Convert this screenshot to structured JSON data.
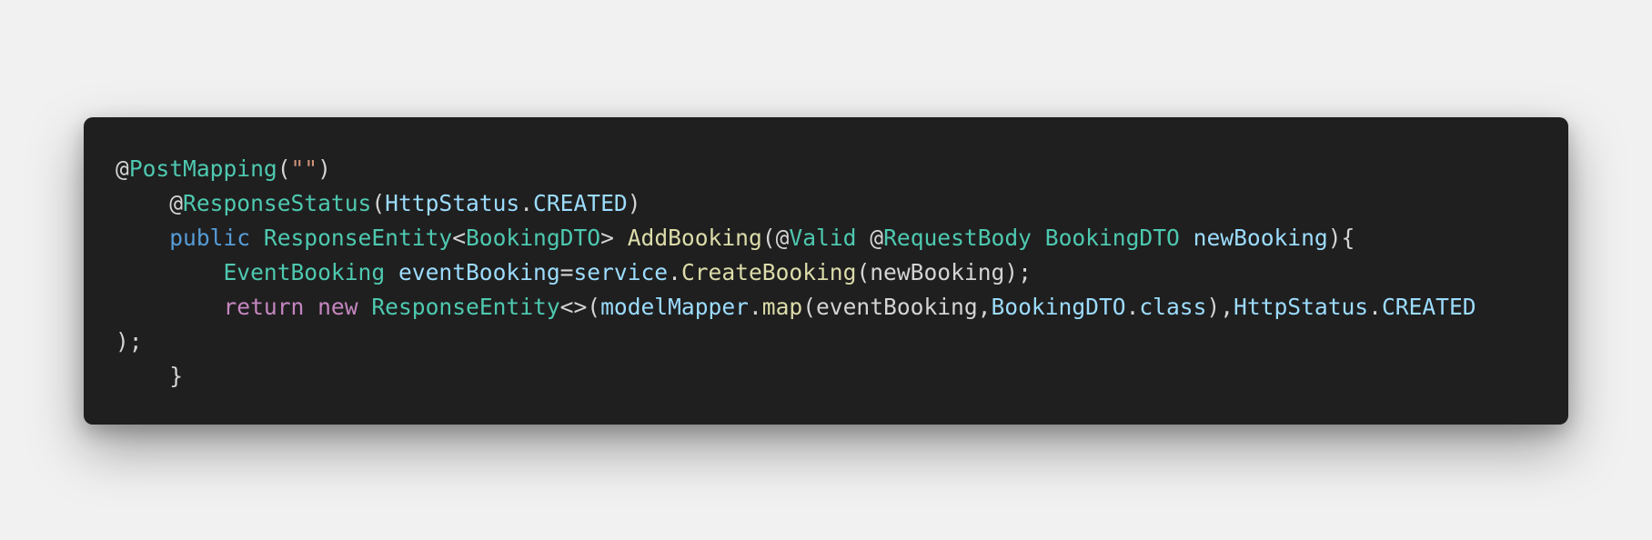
{
  "code_block": {
    "lines": [
      [
        {
          "t": "@",
          "c": "at"
        },
        {
          "t": "PostMapping",
          "c": "type"
        },
        {
          "t": "(",
          "c": "punc"
        },
        {
          "t": "\"\"",
          "c": "str"
        },
        {
          "t": ")",
          "c": "punc"
        }
      ],
      [
        {
          "t": "    @",
          "c": "at"
        },
        {
          "t": "ResponseStatus",
          "c": "type"
        },
        {
          "t": "(",
          "c": "punc"
        },
        {
          "t": "HttpStatus",
          "c": "var"
        },
        {
          "t": ".",
          "c": "punc"
        },
        {
          "t": "CREATED",
          "c": "var"
        },
        {
          "t": ")",
          "c": "punc"
        }
      ],
      [
        {
          "t": "    ",
          "c": "punc"
        },
        {
          "t": "public",
          "c": "kw"
        },
        {
          "t": " ",
          "c": "punc"
        },
        {
          "t": "ResponseEntity",
          "c": "type"
        },
        {
          "t": "<",
          "c": "punc"
        },
        {
          "t": "BookingDTO",
          "c": "type"
        },
        {
          "t": "> ",
          "c": "punc"
        },
        {
          "t": "AddBooking",
          "c": "fn"
        },
        {
          "t": "(@",
          "c": "punc"
        },
        {
          "t": "Valid",
          "c": "type"
        },
        {
          "t": " @",
          "c": "punc"
        },
        {
          "t": "RequestBody",
          "c": "type"
        },
        {
          "t": " ",
          "c": "punc"
        },
        {
          "t": "BookingDTO",
          "c": "type"
        },
        {
          "t": " ",
          "c": "punc"
        },
        {
          "t": "newBooking",
          "c": "var"
        },
        {
          "t": "){",
          "c": "punc"
        }
      ],
      [
        {
          "t": "        ",
          "c": "punc"
        },
        {
          "t": "EventBooking",
          "c": "type"
        },
        {
          "t": " ",
          "c": "punc"
        },
        {
          "t": "eventBooking",
          "c": "var"
        },
        {
          "t": "=",
          "c": "punc"
        },
        {
          "t": "service",
          "c": "var"
        },
        {
          "t": ".",
          "c": "punc"
        },
        {
          "t": "CreateBooking",
          "c": "fn"
        },
        {
          "t": "(newBooking);",
          "c": "punc"
        }
      ],
      [
        {
          "t": "        ",
          "c": "punc"
        },
        {
          "t": "return",
          "c": "ctrl"
        },
        {
          "t": " ",
          "c": "punc"
        },
        {
          "t": "new",
          "c": "ctrl"
        },
        {
          "t": " ",
          "c": "punc"
        },
        {
          "t": "ResponseEntity",
          "c": "type"
        },
        {
          "t": "<>(",
          "c": "punc"
        },
        {
          "t": "modelMapper",
          "c": "var"
        },
        {
          "t": ".",
          "c": "punc"
        },
        {
          "t": "map",
          "c": "fn"
        },
        {
          "t": "(eventBooking,",
          "c": "punc"
        },
        {
          "t": "BookingDTO",
          "c": "var"
        },
        {
          "t": ".",
          "c": "punc"
        },
        {
          "t": "class",
          "c": "var"
        },
        {
          "t": "),",
          "c": "punc"
        },
        {
          "t": "HttpStatus",
          "c": "var"
        },
        {
          "t": ".",
          "c": "punc"
        },
        {
          "t": "CREATED",
          "c": "var"
        }
      ],
      [
        {
          "t": ");",
          "c": "punc"
        }
      ],
      [
        {
          "t": "    }",
          "c": "punc"
        }
      ]
    ]
  },
  "colors": {
    "background": "#f1f1f1",
    "editor_background": "#1f1f1f",
    "default_text": "#d4d4d4",
    "type": "#4ec9b0",
    "string": "#ce9178",
    "variable": "#9cdcfe",
    "keyword": "#569cd6",
    "control_keyword": "#c586c0",
    "function": "#dcdcaa"
  }
}
